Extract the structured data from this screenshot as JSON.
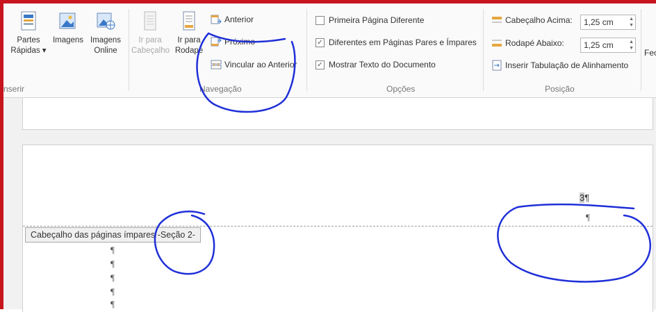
{
  "ribbon": {
    "insert_group": {
      "label": "nserir",
      "buttons": [
        {
          "label_line1": "Partes",
          "label_line2": "Rápidas ▾"
        },
        {
          "label_line1": "Imagens",
          "label_line2": ""
        },
        {
          "label_line1": "Imagens",
          "label_line2": "Online"
        }
      ]
    },
    "navigation_group": {
      "label": "Navegação",
      "goto_header": {
        "line1": "Ir para",
        "line2": "Cabeçalho"
      },
      "goto_footer": {
        "line1": "Ir para",
        "line2": "Rodapé"
      },
      "previous": "Anterior",
      "next": "Próximo",
      "link_to_previous": "Vincular ao Anterior"
    },
    "options_group": {
      "label": "Opções",
      "items": [
        {
          "label": "Primeira Página Diferente",
          "checked": false
        },
        {
          "label": "Diferentes em Páginas Pares e Ímpares",
          "checked": true
        },
        {
          "label": "Mostrar Texto do Documento",
          "checked": true
        }
      ]
    },
    "position_group": {
      "label": "Posição",
      "header_top_label": "Cabeçalho Acima:",
      "header_top_value": "1,25 cm",
      "footer_bottom_label": "Rodapé Abaixo:",
      "footer_bottom_value": "1,25 cm",
      "insert_tab": "Inserir Tabulação de Alinhamento"
    },
    "close_partial": "Fec"
  },
  "document": {
    "header_tag": "Cabeçalho das páginas ímpares -Seção 2-",
    "page_number": "3",
    "pilcrow": "¶"
  },
  "colors": {
    "frame_border": "#c8141c",
    "ink": "#1f2fd8",
    "ribbon_bg": "#fafafa",
    "doc_bg": "#f1f1f1"
  }
}
